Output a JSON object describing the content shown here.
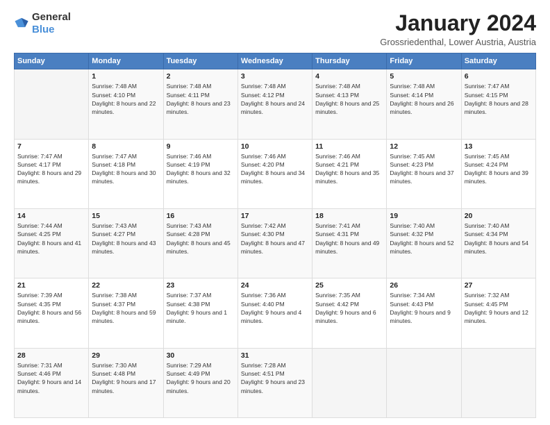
{
  "header": {
    "logo_general": "General",
    "logo_blue": "Blue",
    "month_title": "January 2024",
    "location": "Grossriedenthal, Lower Austria, Austria"
  },
  "weekdays": [
    "Sunday",
    "Monday",
    "Tuesday",
    "Wednesday",
    "Thursday",
    "Friday",
    "Saturday"
  ],
  "weeks": [
    [
      {
        "day": "",
        "sunrise": "",
        "sunset": "",
        "daylight": ""
      },
      {
        "day": "1",
        "sunrise": "Sunrise: 7:48 AM",
        "sunset": "Sunset: 4:10 PM",
        "daylight": "Daylight: 8 hours and 22 minutes."
      },
      {
        "day": "2",
        "sunrise": "Sunrise: 7:48 AM",
        "sunset": "Sunset: 4:11 PM",
        "daylight": "Daylight: 8 hours and 23 minutes."
      },
      {
        "day": "3",
        "sunrise": "Sunrise: 7:48 AM",
        "sunset": "Sunset: 4:12 PM",
        "daylight": "Daylight: 8 hours and 24 minutes."
      },
      {
        "day": "4",
        "sunrise": "Sunrise: 7:48 AM",
        "sunset": "Sunset: 4:13 PM",
        "daylight": "Daylight: 8 hours and 25 minutes."
      },
      {
        "day": "5",
        "sunrise": "Sunrise: 7:48 AM",
        "sunset": "Sunset: 4:14 PM",
        "daylight": "Daylight: 8 hours and 26 minutes."
      },
      {
        "day": "6",
        "sunrise": "Sunrise: 7:47 AM",
        "sunset": "Sunset: 4:15 PM",
        "daylight": "Daylight: 8 hours and 28 minutes."
      }
    ],
    [
      {
        "day": "7",
        "sunrise": "Sunrise: 7:47 AM",
        "sunset": "Sunset: 4:17 PM",
        "daylight": "Daylight: 8 hours and 29 minutes."
      },
      {
        "day": "8",
        "sunrise": "Sunrise: 7:47 AM",
        "sunset": "Sunset: 4:18 PM",
        "daylight": "Daylight: 8 hours and 30 minutes."
      },
      {
        "day": "9",
        "sunrise": "Sunrise: 7:46 AM",
        "sunset": "Sunset: 4:19 PM",
        "daylight": "Daylight: 8 hours and 32 minutes."
      },
      {
        "day": "10",
        "sunrise": "Sunrise: 7:46 AM",
        "sunset": "Sunset: 4:20 PM",
        "daylight": "Daylight: 8 hours and 34 minutes."
      },
      {
        "day": "11",
        "sunrise": "Sunrise: 7:46 AM",
        "sunset": "Sunset: 4:21 PM",
        "daylight": "Daylight: 8 hours and 35 minutes."
      },
      {
        "day": "12",
        "sunrise": "Sunrise: 7:45 AM",
        "sunset": "Sunset: 4:23 PM",
        "daylight": "Daylight: 8 hours and 37 minutes."
      },
      {
        "day": "13",
        "sunrise": "Sunrise: 7:45 AM",
        "sunset": "Sunset: 4:24 PM",
        "daylight": "Daylight: 8 hours and 39 minutes."
      }
    ],
    [
      {
        "day": "14",
        "sunrise": "Sunrise: 7:44 AM",
        "sunset": "Sunset: 4:25 PM",
        "daylight": "Daylight: 8 hours and 41 minutes."
      },
      {
        "day": "15",
        "sunrise": "Sunrise: 7:43 AM",
        "sunset": "Sunset: 4:27 PM",
        "daylight": "Daylight: 8 hours and 43 minutes."
      },
      {
        "day": "16",
        "sunrise": "Sunrise: 7:43 AM",
        "sunset": "Sunset: 4:28 PM",
        "daylight": "Daylight: 8 hours and 45 minutes."
      },
      {
        "day": "17",
        "sunrise": "Sunrise: 7:42 AM",
        "sunset": "Sunset: 4:30 PM",
        "daylight": "Daylight: 8 hours and 47 minutes."
      },
      {
        "day": "18",
        "sunrise": "Sunrise: 7:41 AM",
        "sunset": "Sunset: 4:31 PM",
        "daylight": "Daylight: 8 hours and 49 minutes."
      },
      {
        "day": "19",
        "sunrise": "Sunrise: 7:40 AM",
        "sunset": "Sunset: 4:32 PM",
        "daylight": "Daylight: 8 hours and 52 minutes."
      },
      {
        "day": "20",
        "sunrise": "Sunrise: 7:40 AM",
        "sunset": "Sunset: 4:34 PM",
        "daylight": "Daylight: 8 hours and 54 minutes."
      }
    ],
    [
      {
        "day": "21",
        "sunrise": "Sunrise: 7:39 AM",
        "sunset": "Sunset: 4:35 PM",
        "daylight": "Daylight: 8 hours and 56 minutes."
      },
      {
        "day": "22",
        "sunrise": "Sunrise: 7:38 AM",
        "sunset": "Sunset: 4:37 PM",
        "daylight": "Daylight: 8 hours and 59 minutes."
      },
      {
        "day": "23",
        "sunrise": "Sunrise: 7:37 AM",
        "sunset": "Sunset: 4:38 PM",
        "daylight": "Daylight: 9 hours and 1 minute."
      },
      {
        "day": "24",
        "sunrise": "Sunrise: 7:36 AM",
        "sunset": "Sunset: 4:40 PM",
        "daylight": "Daylight: 9 hours and 4 minutes."
      },
      {
        "day": "25",
        "sunrise": "Sunrise: 7:35 AM",
        "sunset": "Sunset: 4:42 PM",
        "daylight": "Daylight: 9 hours and 6 minutes."
      },
      {
        "day": "26",
        "sunrise": "Sunrise: 7:34 AM",
        "sunset": "Sunset: 4:43 PM",
        "daylight": "Daylight: 9 hours and 9 minutes."
      },
      {
        "day": "27",
        "sunrise": "Sunrise: 7:32 AM",
        "sunset": "Sunset: 4:45 PM",
        "daylight": "Daylight: 9 hours and 12 minutes."
      }
    ],
    [
      {
        "day": "28",
        "sunrise": "Sunrise: 7:31 AM",
        "sunset": "Sunset: 4:46 PM",
        "daylight": "Daylight: 9 hours and 14 minutes."
      },
      {
        "day": "29",
        "sunrise": "Sunrise: 7:30 AM",
        "sunset": "Sunset: 4:48 PM",
        "daylight": "Daylight: 9 hours and 17 minutes."
      },
      {
        "day": "30",
        "sunrise": "Sunrise: 7:29 AM",
        "sunset": "Sunset: 4:49 PM",
        "daylight": "Daylight: 9 hours and 20 minutes."
      },
      {
        "day": "31",
        "sunrise": "Sunrise: 7:28 AM",
        "sunset": "Sunset: 4:51 PM",
        "daylight": "Daylight: 9 hours and 23 minutes."
      },
      {
        "day": "",
        "sunrise": "",
        "sunset": "",
        "daylight": ""
      },
      {
        "day": "",
        "sunrise": "",
        "sunset": "",
        "daylight": ""
      },
      {
        "day": "",
        "sunrise": "",
        "sunset": "",
        "daylight": ""
      }
    ]
  ]
}
